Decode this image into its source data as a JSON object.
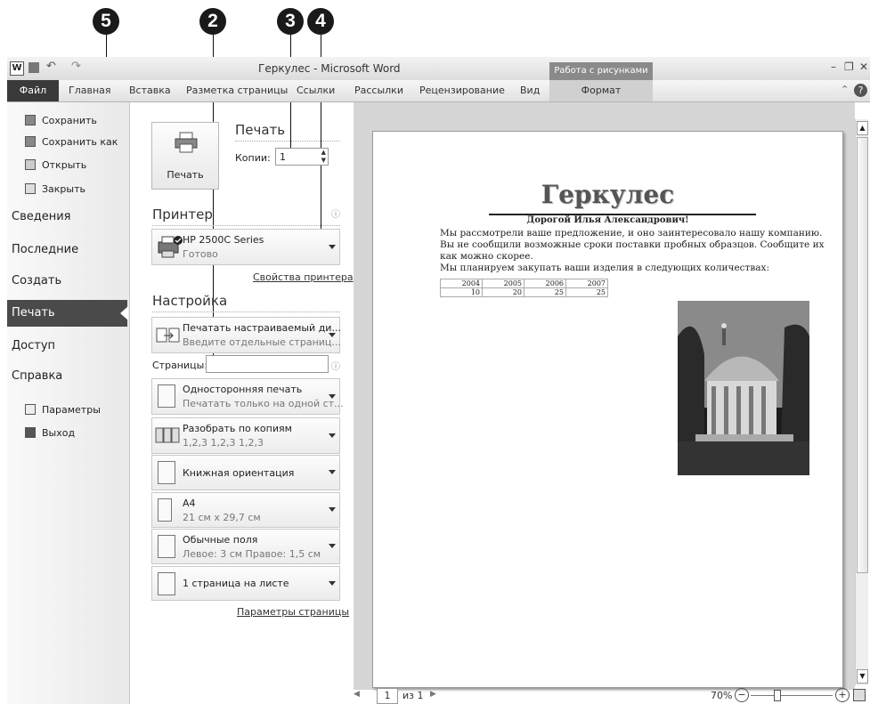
{
  "callouts": [
    "5",
    "2",
    "3",
    "4"
  ],
  "titlebar": {
    "title": "Геркулес - Microsoft Word",
    "context_group": "Работа с рисунками"
  },
  "ribbon": {
    "tabs": [
      "Файл",
      "Главная",
      "Вставка",
      "Разметка страницы",
      "Ссылки",
      "Рассылки",
      "Рецензирование",
      "Вид",
      "Формат"
    ]
  },
  "nav": {
    "small_top": [
      "Сохранить",
      "Сохранить как",
      "Открыть",
      "Закрыть"
    ],
    "big": [
      "Сведения",
      "Последние",
      "Создать",
      "Печать",
      "Доступ",
      "Справка"
    ],
    "small_bottom": [
      "Параметры",
      "Выход"
    ]
  },
  "print": {
    "button_label": "Печать",
    "header": "Печать",
    "copies_label": "Копии:",
    "copies_value": "1"
  },
  "printer": {
    "header": "Принтер",
    "name": "HP 2500C Series",
    "status": "Готово",
    "properties_link": "Свойства принтера"
  },
  "settings": {
    "header": "Настройка",
    "range_title": "Печатать настраиваемый ди...",
    "range_sub": "Введите отдельные страниц...",
    "pages_label": "Страницы:",
    "pages_value": "",
    "sides_title": "Односторонняя печать",
    "sides_sub": "Печатать только на одной ст...",
    "collate_title": "Разобрать по копиям",
    "collate_sub": "1,2,3   1,2,3   1,2,3",
    "orientation": "Книжная ориентация",
    "paper_title": "А4",
    "paper_sub": "21 см x 29,7 см",
    "margins_title": "Обычные поля",
    "margins_sub": "Левое: 3 см   Правое: 1,5 см",
    "pages_per_sheet": "1 страница на листе",
    "page_setup_link": "Параметры страницы"
  },
  "document": {
    "title": "Геркулес",
    "greeting": "Дорогой Илья Александрович!",
    "body_lines": [
      "Мы рассмотрели ваше предложение, и оно заинтересовало нашу компанию.",
      "Вы не сообщили возможные сроки поставки пробных образцов. Сообщите их",
      "как можно скорее.",
      "Мы планируем закупать ваши изделия в следующих количествах:"
    ],
    "table": {
      "years": [
        "2004",
        "2005",
        "2006",
        "2007"
      ],
      "values": [
        "10",
        "20",
        "25",
        "25"
      ]
    }
  },
  "status": {
    "page_value": "1",
    "page_of": "из 1",
    "zoom": "70%"
  }
}
